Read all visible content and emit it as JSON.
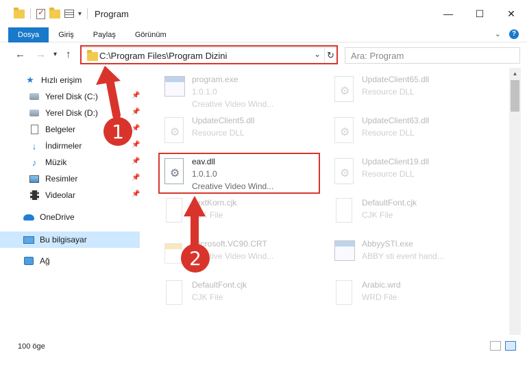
{
  "window": {
    "title": "Program",
    "controls": {
      "minimize": "—",
      "maximize": "☐",
      "close": "✕"
    }
  },
  "ribbon": {
    "tabs": [
      {
        "label": "Dosya",
        "active": true
      },
      {
        "label": "Giriş"
      },
      {
        "label": "Paylaş"
      },
      {
        "label": "Görünüm"
      }
    ],
    "expand_icon": "⌄",
    "help_icon": "?"
  },
  "address": {
    "path": "C:\\Program Files\\Program Dizini",
    "search_placeholder": "Ara: Program"
  },
  "nav_pane": {
    "items": [
      {
        "label": "Hızlı erişim"
      },
      {
        "label": "Yerel Disk (C:)",
        "pinned": true
      },
      {
        "label": "Yerel Disk (D:)",
        "pinned": true
      },
      {
        "label": "Belgeler",
        "pinned": true
      },
      {
        "label": "İndirmeler",
        "pinned": true
      },
      {
        "label": "Müzik",
        "pinned": true
      },
      {
        "label": "Resimler",
        "pinned": true
      },
      {
        "label": "Videolar",
        "pinned": true
      },
      {
        "label": "OneDrive"
      },
      {
        "label": "Bu bilgisayar",
        "selected": true
      },
      {
        "label": "Ağ"
      }
    ]
  },
  "files": [
    {
      "name": "program.exe",
      "line2": "1.0.1.0",
      "line3": "Creative Video Wind...",
      "faded": true,
      "icon": "exe-icon"
    },
    {
      "name": "UpdateClient65.dll",
      "line2": "Resource DLL",
      "faded": true,
      "icon": "dll-icon"
    },
    {
      "name": "UpdateClient5.dll",
      "line2": "Resource DLL",
      "faded": true,
      "icon": "dll-icon"
    },
    {
      "name": "UpdateClient63.dll",
      "line2": "Resource DLL",
      "faded": true,
      "icon": "dll-icon"
    },
    {
      "name": "eav.dll",
      "line2": "1.0.1.0",
      "line3": "Creative Video Wind...",
      "faded": false,
      "icon": "dll-icon"
    },
    {
      "name": "UpdateClient19.dll",
      "line2": "Resource DLL",
      "faded": true,
      "icon": "dll-icon"
    },
    {
      "name": "TextKorn.cjk",
      "line2": "CJK File",
      "faded": true,
      "icon": "file-icon"
    },
    {
      "name": "DefaultFont.cjk",
      "line2": "CJK File",
      "faded": true,
      "icon": "file-icon"
    },
    {
      "name": "Microsoft.VC90.CRT",
      "line2": "",
      "line3": "Creative Video Wind...",
      "faded": true,
      "icon": "folder-icon"
    },
    {
      "name": "AbbyySTI.exe",
      "line2": "ABBY sti event hand...",
      "faded": true,
      "icon": "exe-icon"
    },
    {
      "name": "DefaultFont.cjk",
      "line2": "CJK File",
      "faded": true,
      "icon": "file-icon"
    },
    {
      "name": "Arabic.wrd",
      "line2": "WRD File",
      "faded": true,
      "icon": "file-icon"
    }
  ],
  "status": {
    "count": "100 öge"
  },
  "annotations": {
    "step1": "1",
    "step2": "2",
    "color": "#d9342b"
  }
}
